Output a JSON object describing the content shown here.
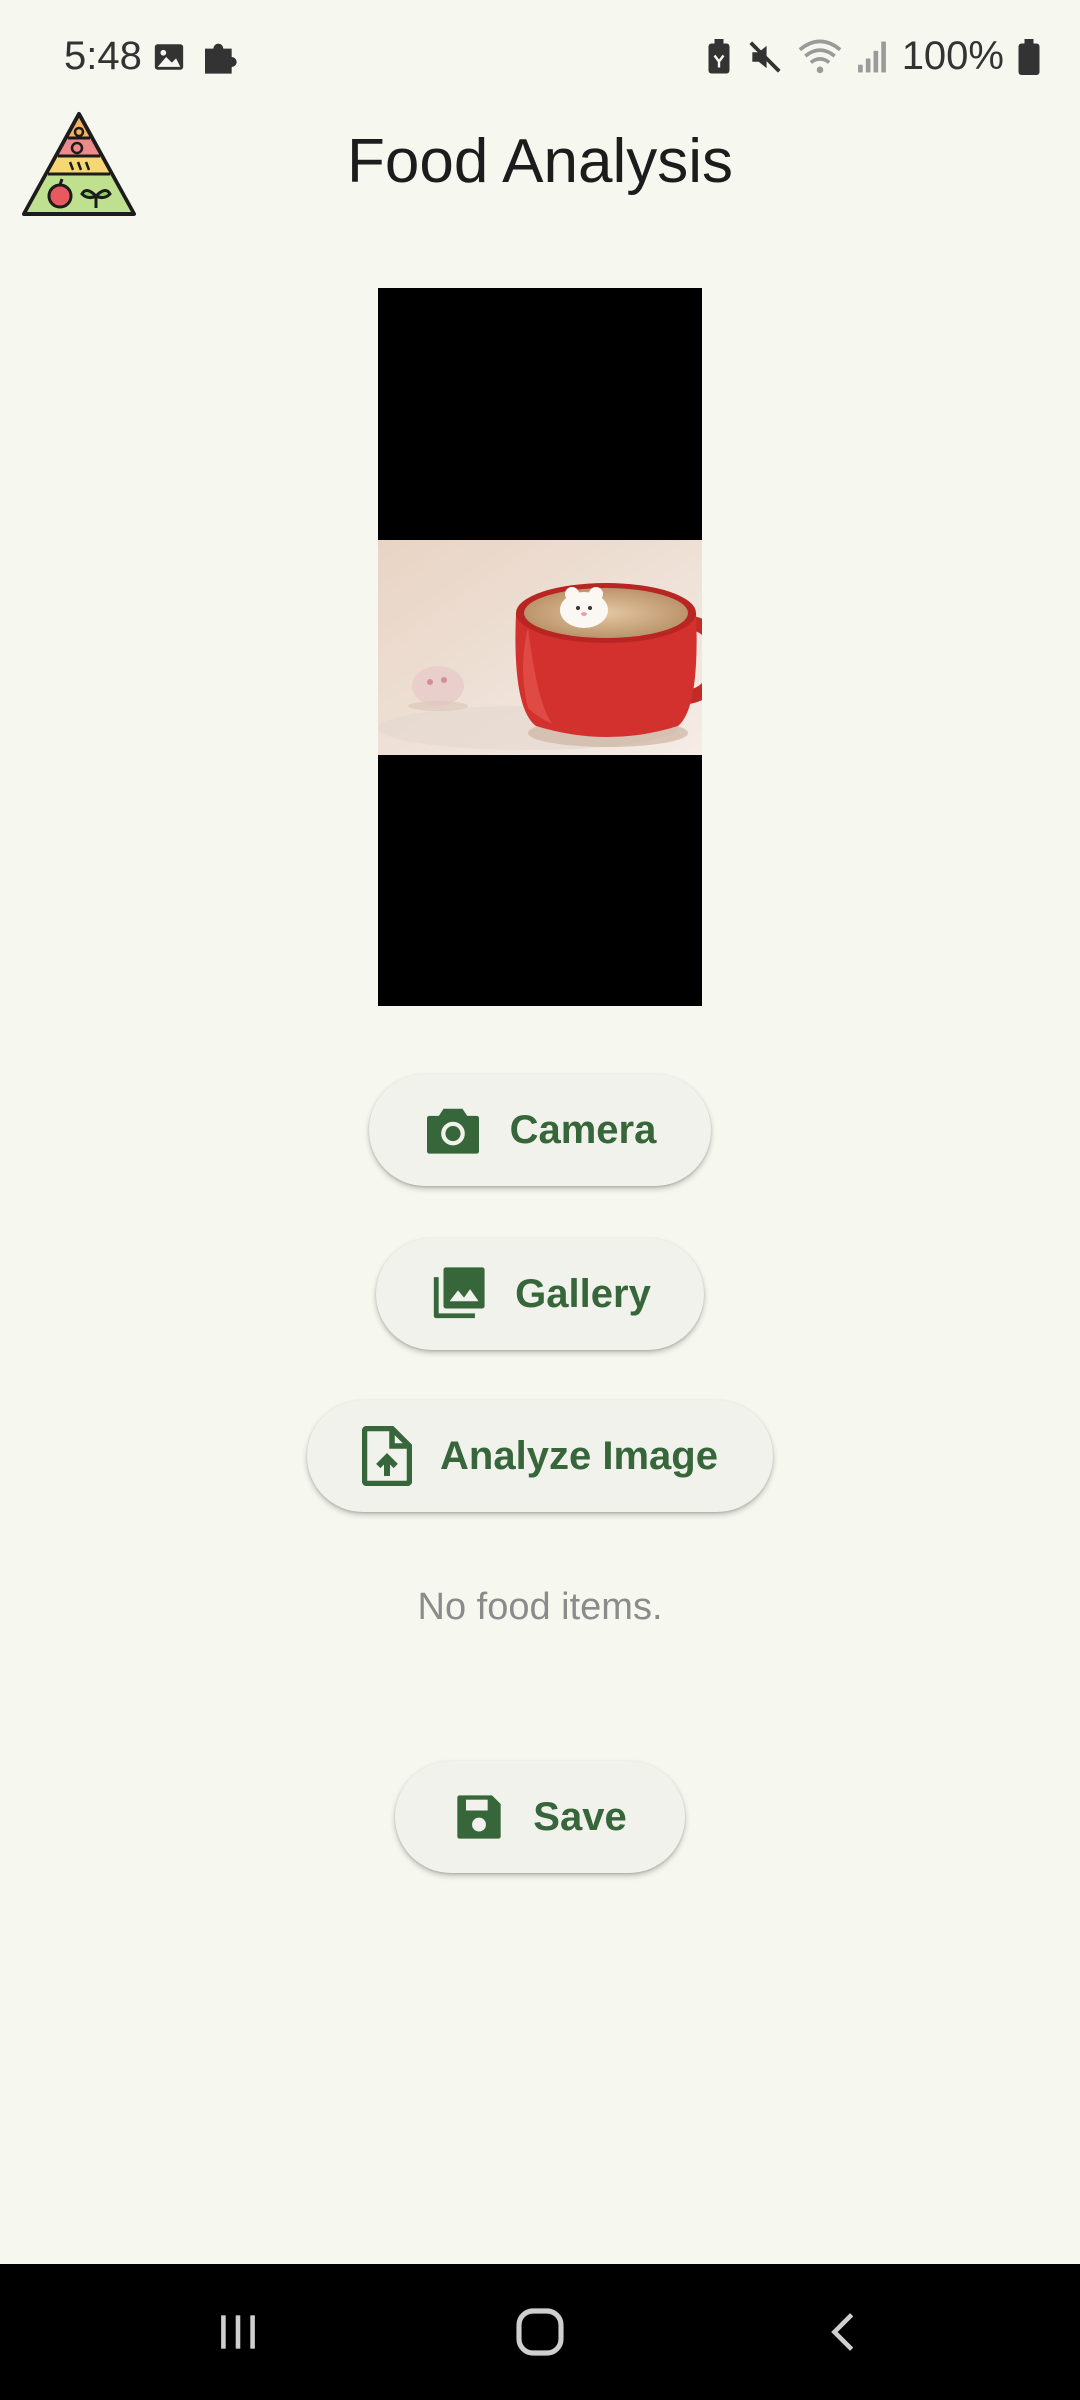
{
  "status_bar": {
    "time": "5:48",
    "battery": "100%",
    "left_icons": [
      "image-icon",
      "puzzle-icon"
    ],
    "right_icons": [
      "battery-saver-icon",
      "mute-icon",
      "wifi-icon",
      "signal-icon",
      "battery-icon"
    ]
  },
  "app_bar": {
    "title": "Food Analysis",
    "logo": "food-pyramid-icon"
  },
  "buttons": {
    "camera": "Camera",
    "gallery": "Gallery",
    "analyze": "Analyze Image",
    "save": "Save"
  },
  "results": {
    "empty_message": "No food items."
  },
  "colors": {
    "background": "#f6f8f0",
    "accent": "#36663a",
    "button_bg": "#f1f2ec"
  }
}
